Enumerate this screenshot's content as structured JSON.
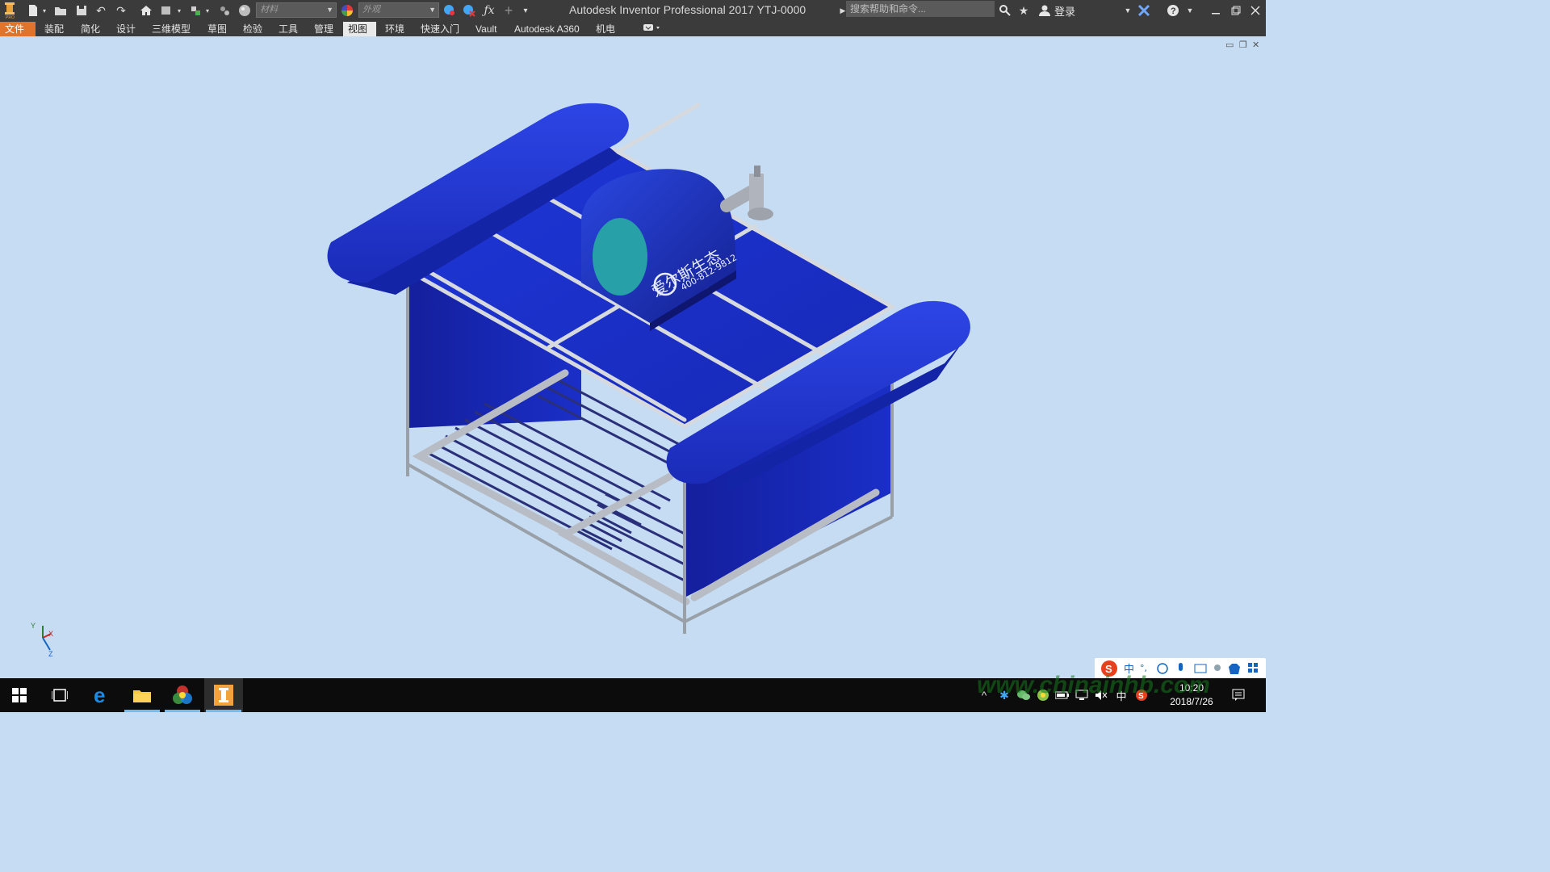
{
  "app": {
    "title": "Autodesk Inventor Professional 2017   YTJ-0000",
    "material_placeholder": "材料",
    "appearance_placeholder": "外观",
    "search_placeholder": "搜索帮助和命令...",
    "login_label": "登录"
  },
  "tabs": [
    {
      "label": "文件"
    },
    {
      "label": "装配"
    },
    {
      "label": "简化"
    },
    {
      "label": "设计"
    },
    {
      "label": "三维模型"
    },
    {
      "label": "草图"
    },
    {
      "label": "检验"
    },
    {
      "label": "工具"
    },
    {
      "label": "管理"
    },
    {
      "label": "视图"
    },
    {
      "label": "环境"
    },
    {
      "label": "快速入门"
    },
    {
      "label": "Vault"
    },
    {
      "label": "Autodesk A360"
    },
    {
      "label": "机电"
    }
  ],
  "active_tab": "视图",
  "model": {
    "brand_text": "爱尔斯生态",
    "phone_text": "400-812-9812"
  },
  "axis": {
    "x": "X",
    "y": "Y",
    "z": "Z"
  },
  "tray": {
    "time": "10:20",
    "date": "2018/7/26",
    "ime_lang": "中"
  },
  "watermark": "www.chinainhb.com",
  "colors": {
    "viewport_bg": "#c5dcf2",
    "model_blue": "#1a2fc8",
    "file_tab": "#e0742a",
    "taskbar_bg": "#0c0c0c"
  }
}
